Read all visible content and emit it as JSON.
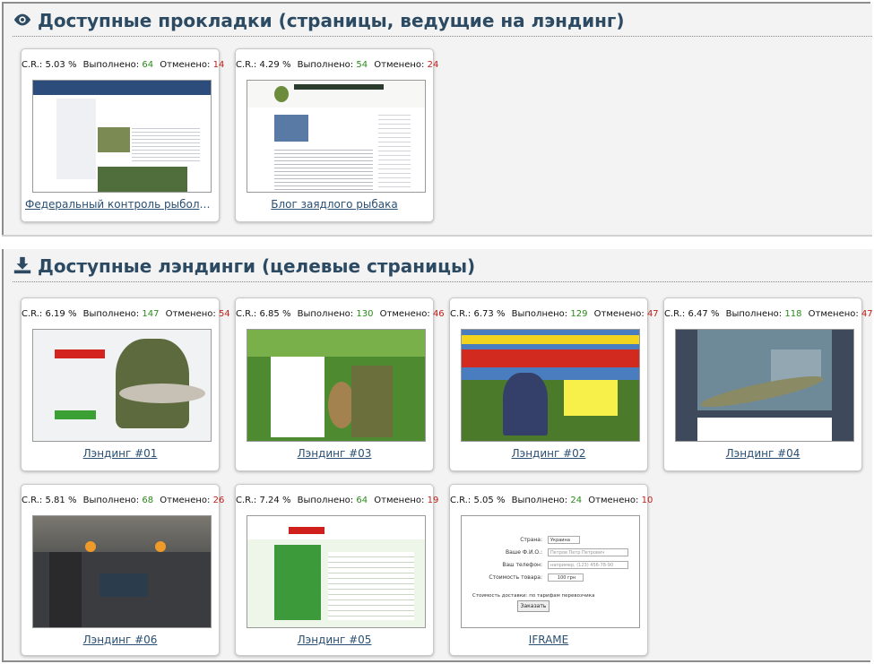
{
  "sections": {
    "prokladki": {
      "title": "Доступные прокладки (страницы, ведущие на лэндинг)",
      "icon": "eye-icon",
      "cards": [
        {
          "cr_label": "C.R.:",
          "cr": "5.03 %",
          "done_label": "Выполнено:",
          "done": "64",
          "cancel_label": "Отменено:",
          "cancel": "14",
          "link": "Федеральный контроль рыболовства"
        },
        {
          "cr_label": "C.R.:",
          "cr": "4.29 %",
          "done_label": "Выполнено:",
          "done": "54",
          "cancel_label": "Отменено:",
          "cancel": "24",
          "link": "Блог заядлого рыбака"
        }
      ]
    },
    "landings": {
      "title": "Доступные лэндинги (целевые страницы)",
      "icon": "download-icon",
      "cards": [
        {
          "cr_label": "C.R.:",
          "cr": "6.19 %",
          "done_label": "Выполнено:",
          "done": "147",
          "cancel_label": "Отменено:",
          "cancel": "54",
          "link": "Лэндинг #01"
        },
        {
          "cr_label": "C.R.:",
          "cr": "6.85 %",
          "done_label": "Выполнено:",
          "done": "130",
          "cancel_label": "Отменено:",
          "cancel": "46",
          "link": "Лэндинг #03"
        },
        {
          "cr_label": "C.R.:",
          "cr": "6.73 %",
          "done_label": "Выполнено:",
          "done": "129",
          "cancel_label": "Отменено:",
          "cancel": "47",
          "link": "Лэндинг #02"
        },
        {
          "cr_label": "C.R.:",
          "cr": "6.47 %",
          "done_label": "Выполнено:",
          "done": "118",
          "cancel_label": "Отменено:",
          "cancel": "47",
          "link": "Лэндинг #04"
        },
        {
          "cr_label": "C.R.:",
          "cr": "5.81 %",
          "done_label": "Выполнено:",
          "done": "68",
          "cancel_label": "Отменено:",
          "cancel": "26",
          "link": "Лэндинг #06"
        },
        {
          "cr_label": "C.R.:",
          "cr": "7.24 %",
          "done_label": "Выполнено:",
          "done": "64",
          "cancel_label": "Отменено:",
          "cancel": "19",
          "link": "Лэндинг #05"
        },
        {
          "cr_label": "C.R.:",
          "cr": "5.05 %",
          "done_label": "Выполнено:",
          "done": "24",
          "cancel_label": "Отменено:",
          "cancel": "10",
          "link": "IFRAME"
        }
      ]
    }
  },
  "iframe_form": {
    "country_label": "Страна:",
    "country_value": "Украина",
    "name_label": "Ваше Ф.И.О.:",
    "name_placeholder": "Петров Петр Петрович",
    "phone_label": "Ваш телефон:",
    "phone_placeholder": "например, (123) 456-78-90",
    "price_label": "Стоимость товара:",
    "price_value": "100 грн",
    "delivery_note": "Стоимость доставки: по тарифам перевозчика",
    "order_button": "Заказать"
  },
  "colors": {
    "done": "#2a8a1a",
    "cancel": "#c0201b",
    "title": "#2d4a63",
    "link": "#2a4f73"
  }
}
